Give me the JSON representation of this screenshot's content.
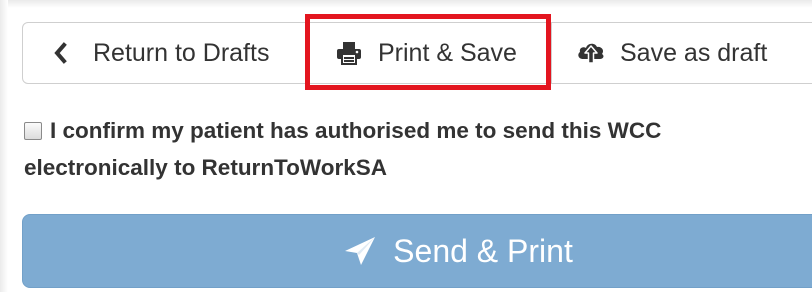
{
  "toolbar": {
    "return_label": "Return to Drafts",
    "print_label": "Print & Save",
    "draft_label": "Save as draft"
  },
  "consent": {
    "line1": "I confirm my patient has authorised me to send this WCC",
    "line2": "electronically to ReturnToWorkSA",
    "checked": false
  },
  "send": {
    "label": "Send & Print",
    "enabled": false
  },
  "icons": {
    "return": "chevron-left-icon",
    "print": "print-icon",
    "draft": "cloud-upload-icon",
    "send": "send-icon"
  },
  "colors": {
    "highlight": "#e3151f",
    "send_button": "#7eabd2",
    "text": "#333333"
  }
}
